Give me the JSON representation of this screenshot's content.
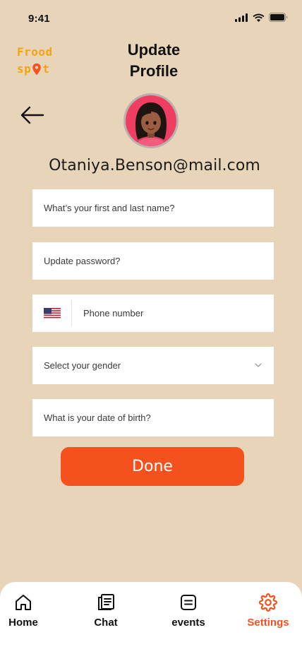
{
  "status_bar": {
    "time": "9:41"
  },
  "brand": {
    "line1": "Frood",
    "line2_left": "sp",
    "line2_right": "t"
  },
  "header": {
    "title": "Update Profile"
  },
  "profile": {
    "email": "Otaniya.Benson@mail.com"
  },
  "form": {
    "name_placeholder": "What’s your first and last name?",
    "password_placeholder": "Update password?",
    "phone_placeholder": "Phone number",
    "gender_placeholder": "Select your gender",
    "dob_placeholder": "What is your date of birth?",
    "done_label": "Done"
  },
  "tabs": [
    {
      "label": "Home",
      "icon": "home-icon"
    },
    {
      "label": "Chat",
      "icon": "document-icon"
    },
    {
      "label": "events",
      "icon": "list-icon"
    },
    {
      "label": "Settings",
      "icon": "gear-icon",
      "active": true
    }
  ],
  "colors": {
    "background": "#E8D5B9",
    "accent": "#F4511E",
    "brand": "#F4A40A"
  }
}
